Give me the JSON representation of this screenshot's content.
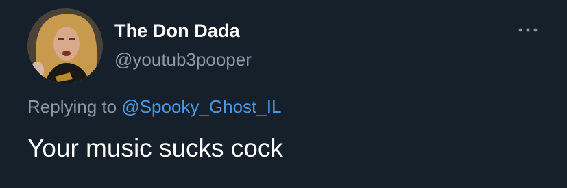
{
  "tweet": {
    "display_name": "The Don Dada",
    "handle": "@youtub3pooper",
    "reply_prefix": "Replying to",
    "reply_mention": "@Spooky_Ghost_IL",
    "text": "Your music sucks cock"
  },
  "icons": {
    "avatar": "user-avatar",
    "more": "more-horizontal-icon"
  },
  "colors": {
    "background": "#15202b",
    "secondary_text": "#8b98a5",
    "link": "#4a99e9",
    "primary_text": "#ffffff"
  }
}
